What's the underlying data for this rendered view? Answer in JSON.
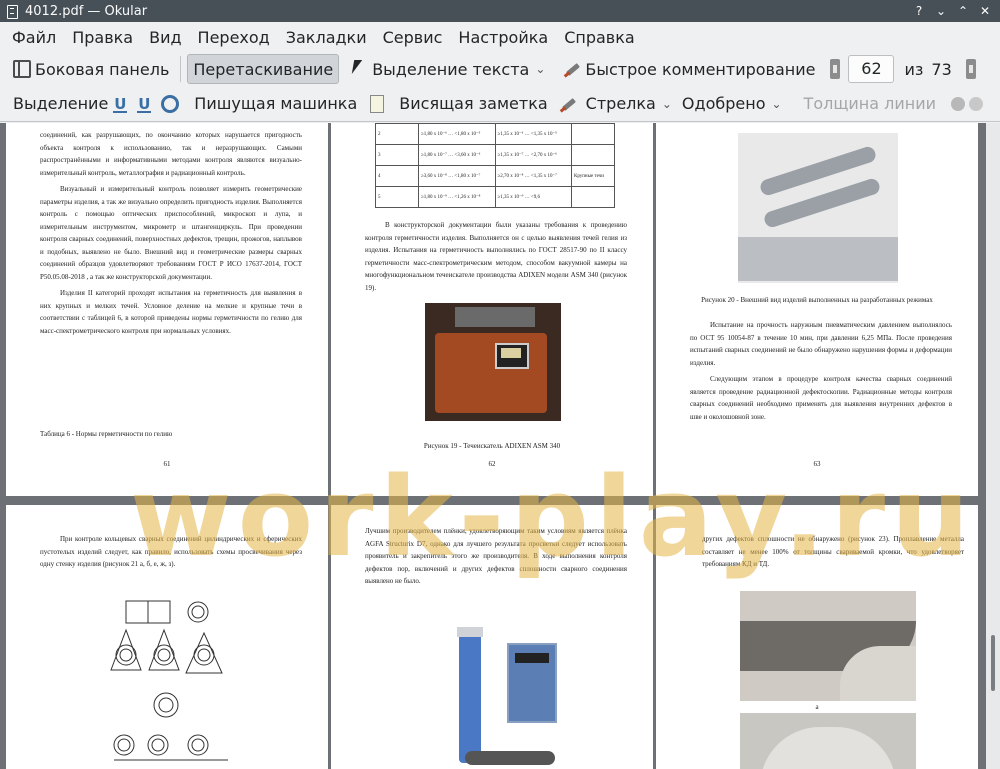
{
  "window": {
    "title": "4012.pdf — Okular"
  },
  "menu": [
    "Файл",
    "Правка",
    "Вид",
    "Переход",
    "Закладки",
    "Сервис",
    "Настройка",
    "Справка"
  ],
  "toolbar1": {
    "sidebar": "Боковая панель",
    "drag": "Перетаскивание",
    "text_select": "Выделение текста",
    "quick_comment": "Быстрое комментирование",
    "page_current": "62",
    "page_of": "из",
    "page_total": "73"
  },
  "toolbar2": {
    "selection": "Выделение",
    "typewriter": "Пишущая машинка",
    "sticky_note": "Висящая заметка",
    "arrow": "Стрелка",
    "approved": "Одобрено",
    "line_width": "Толщина линии"
  },
  "watermark": "work-play.ru",
  "pages": {
    "p61": {
      "paras": [
        "соединений, как разрушающих, по окончанию которых нарушается пригодность объекта контроля к использованию, так и неразрушающих. Самыми распространёнными и информативными методами контроля являются визуально-измерительный контроль, металлография и радиационный контроль.",
        "Визуальный и измерительный контроль позволяет измерить геометрические параметры изделия, а так же визуально определить пригодность изделия. Выполняется контроль с помощью оптических приспособлений, микроскоп и лупа, и измерительным инструментом, микрометр и штангенциркуль. При проведении контроля сварных соединений, поверхностных дефектов, трещин, прожогов, наплывов и подобных, выявлено не было. Внешний вид и геометрические размеры сварных соединений образцов удовлетворяют требованиям ГОСТ Р ИСО 17637-2014, ГОСТ Р50.05.08-2018 , а так же конструкторской документации.",
        "Изделия II категорий проходят испытания на герметичность для выявления в них крупных и мелких течей. Условное деление на мелкие и крупные течи в соответствии с таблицей 6, в которой приведены нормы герметичности по гелию для масс-спектрометрического контроля при нормальных условиях."
      ],
      "table_caption": "Таблица 6 - Нормы герметичности по гелию",
      "number": "61"
    },
    "p62": {
      "table": [
        [
          "2",
          "≥1,80 x 10⁻⁶ … <1,80 x 10⁻⁵",
          "≥1,35 x 10⁻⁶ … <1,35 x 10⁻⁵",
          ""
        ],
        [
          "3",
          "≥1,80 x 10⁻⁷ … <3,60 x 10⁻⁶",
          "≥1,35 x 10⁻⁷ … <2,70 x 10⁻⁶",
          ""
        ],
        [
          "4",
          "≥3,60 x 10⁻⁸ … <1,80 x 10⁻⁷",
          "≥2,70 x 10⁻⁸ … <1,35 x 10⁻⁷",
          "Крупные течи"
        ],
        [
          "5",
          "≥1,80 x 10⁻⁹ … <1,26 x 10⁻⁸",
          "≥1,35 x 10⁻⁹ … <9,6",
          ""
        ]
      ],
      "para": "В конструкторской документации были указаны требования к проведению контроля герметичности изделия. Выполняется он с целью выявления течей гелия из изделия. Испытания на герметичность выполнялись по ГОСТ 28517-90 по II классу герметичности масс-спектрометрическим методом, способом вакуумной камеры на многофункциональном течеискателе производства ADIXEN модели ASM 340 (рисунок 19).",
      "caption": "Рисунок 19 - Течеискатель ADIXEN ASM 340",
      "number": "62"
    },
    "p63": {
      "caption": "Рисунок 20 - Внешний вид изделий выполненных на разработанных режимах",
      "paras": [
        "Испытание на прочность наружным пневматическим давлением выполнялось по ОСТ 95 10054-87 в течение 10 мин, при давлении 6,25 МПа. После проведения испытаний сварных соединений не было обнаружено нарушения формы и деформации изделия.",
        "Следующим этапом в процедуре контроля качества сварных соединений является проведение радиационной дефектоскопии. Радиационные методы контроля сварных соединений необходимо применять для выявления внутренних дефектов в шве и околошовной зоне."
      ],
      "number": "63"
    },
    "p64": {
      "para": "При контроле кольцевых сварных соединений цилиндрических и сферических пустотелых изделий следует, как правило, использовать схемы просвечивания через одну стенку изделия (рисунок 21 а, б, е, ж, з)."
    },
    "p65": {
      "para": "Лучшим производителем плёнки, удовлетворяющим таким условиям является плёнка AGFA Structurix D7, однако для лучшего результата просветки следует использовать проявитель и закрепитель этого же производителя. В ходе выполнения контроля дефектов пор, включений и других дефектов сплошности сварного соединения выявлено не было."
    },
    "p66": {
      "para": "других дефектов сплошности не обнаружено (рисунок 23). Проплавление металла составляет не менее 100% от толщины свариваемой кромки, что удовлетворяет требованиям КД и ТД.",
      "fig_label": "а"
    }
  }
}
